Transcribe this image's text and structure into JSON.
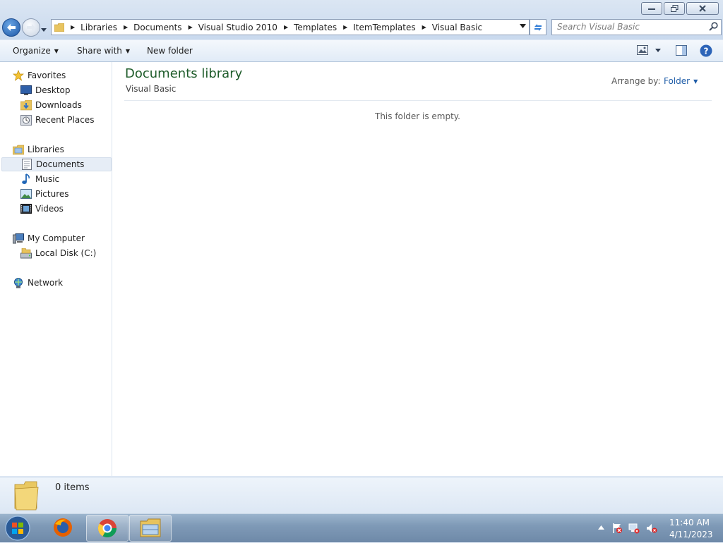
{
  "window": {
    "minimize_icon": "minimize-icon",
    "restore_icon": "restore-icon",
    "close_icon": "close-icon"
  },
  "address": {
    "crumbs": [
      "Libraries",
      "Documents",
      "Visual Studio 2010",
      "Templates",
      "ItemTemplates",
      "Visual Basic"
    ]
  },
  "search": {
    "placeholder": "Search Visual Basic"
  },
  "toolbar": {
    "organize": "Organize",
    "share_with": "Share with",
    "new_folder": "New folder"
  },
  "navpane": {
    "favorites": "Favorites",
    "desktop": "Desktop",
    "downloads": "Downloads",
    "recent_places": "Recent Places",
    "libraries": "Libraries",
    "documents": "Documents",
    "music": "Music",
    "pictures": "Pictures",
    "videos": "Videos",
    "my_computer": "My Computer",
    "local_disk": "Local Disk (C:)",
    "network": "Network"
  },
  "content": {
    "title": "Documents library",
    "subtitle": "Visual Basic",
    "arrange_label": "Arrange by:",
    "arrange_value": "Folder",
    "empty_message": "This folder is empty."
  },
  "details": {
    "items": "0 items"
  },
  "taskbar": {
    "time": "11:40 AM",
    "date": "4/11/2023"
  },
  "colors": {
    "title_green": "#1e5c2a",
    "link_blue": "#1f5da8",
    "selection": "#e6edf6"
  }
}
